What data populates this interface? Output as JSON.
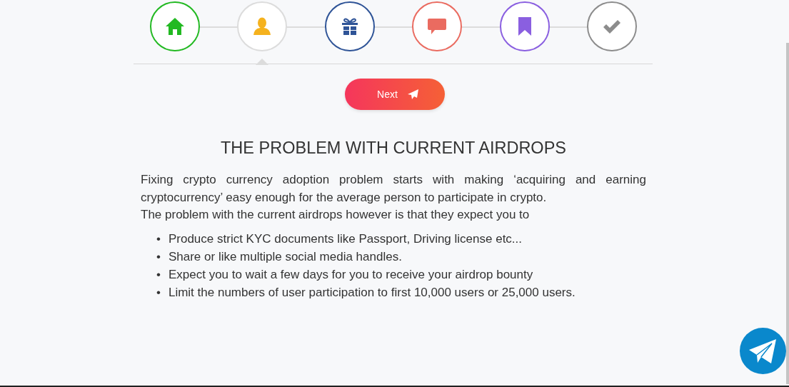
{
  "steps": [
    {
      "kind": "home",
      "color": "#22b922",
      "selected": false
    },
    {
      "kind": "user",
      "color": "#f5b21e",
      "selected": true
    },
    {
      "kind": "gift",
      "color": "#2f5497",
      "selected": false
    },
    {
      "kind": "chat",
      "color": "#ea6b60",
      "selected": false
    },
    {
      "kind": "bookmark",
      "color": "#8a5fe0",
      "selected": false
    },
    {
      "kind": "check",
      "color": "#8c8c8c",
      "selected": false
    }
  ],
  "next_button": {
    "label": "Next"
  },
  "title": "THE PROBLEM WITH CURRENT AIRDROPS",
  "paragraphs": [
    "Fixing crypto currency adoption problem starts with making ‘acquiring and earning cryptocurrency’ easy enough for the average person to participate in crypto.",
    "The problem with the current airdrops however is that they expect you to"
  ],
  "bullets": [
    {
      "marker": "•",
      "text": "Produce strict KYC documents like Passport, Driving license etc..."
    },
    {
      "marker": "•",
      "text": "Share or like multiple social media handles."
    },
    {
      "marker": "•",
      "text": "Expect you to wait a few days for you to receive your airdrop bounty"
    },
    {
      "marker": "•",
      "text": "Limit the numbers of user participation to first 10,000 users or 25,000 users."
    }
  ]
}
